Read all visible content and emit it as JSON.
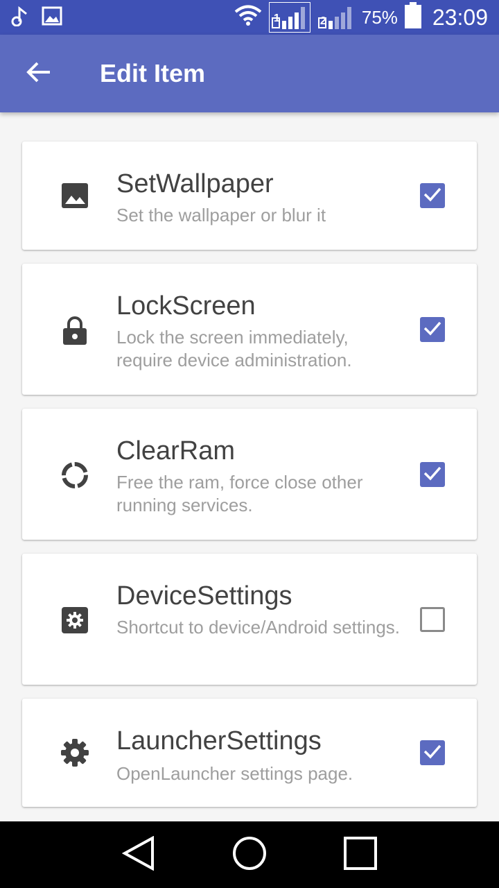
{
  "status_bar": {
    "battery_percent": "75%",
    "time": "23:09",
    "sim1_label": "1",
    "sim2_label": "2"
  },
  "app_bar": {
    "title": "Edit Item"
  },
  "items": [
    {
      "title": "SetWallpaper",
      "description": "Set the wallpaper or blur it",
      "icon": "image-icon",
      "checked": true
    },
    {
      "title": "LockScreen",
      "description": "Lock the screen immediately, require device administration.",
      "icon": "lock-icon",
      "checked": true
    },
    {
      "title": "ClearRam",
      "description": "Free the ram, force close other running services.",
      "icon": "loading-ring-icon",
      "checked": true
    },
    {
      "title": "DeviceSettings",
      "description": "Shortcut to device/Android settings.",
      "icon": "settings-box-icon",
      "checked": false
    },
    {
      "title": "LauncherSettings",
      "description": "OpenLauncher settings page.",
      "icon": "gear-icon",
      "checked": true
    }
  ],
  "colors": {
    "status_bar": "#3f51b5",
    "app_bar": "#5c6bc0",
    "checkbox_checked": "#5c6bc0",
    "icon": "#424242"
  }
}
